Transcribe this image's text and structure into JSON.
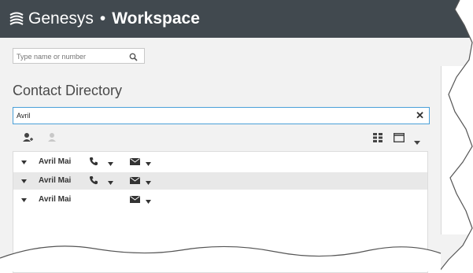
{
  "header": {
    "brand": "Genesys",
    "separator": "•",
    "app": "Workspace"
  },
  "search": {
    "placeholder": "Type name or number"
  },
  "directory": {
    "title": "Contact Directory",
    "filter_value": "Avril",
    "rows": [
      {
        "name": "Avril Mai",
        "has_phone": true
      },
      {
        "name": "Avril Mai",
        "has_phone": true
      },
      {
        "name": "Avril Mai",
        "has_phone": false
      }
    ]
  },
  "colors": {
    "header_bg": "#41494f",
    "filter_border": "#4aa0d8",
    "row_alt": "#e8e8e8"
  },
  "icons": [
    "logo-icon",
    "search-icon",
    "clear-icon",
    "add-contact-icon",
    "remove-contact-icon",
    "grid-view-icon",
    "window-icon",
    "chevron-down-icon",
    "phone-icon",
    "mail-icon",
    "save-icon"
  ]
}
